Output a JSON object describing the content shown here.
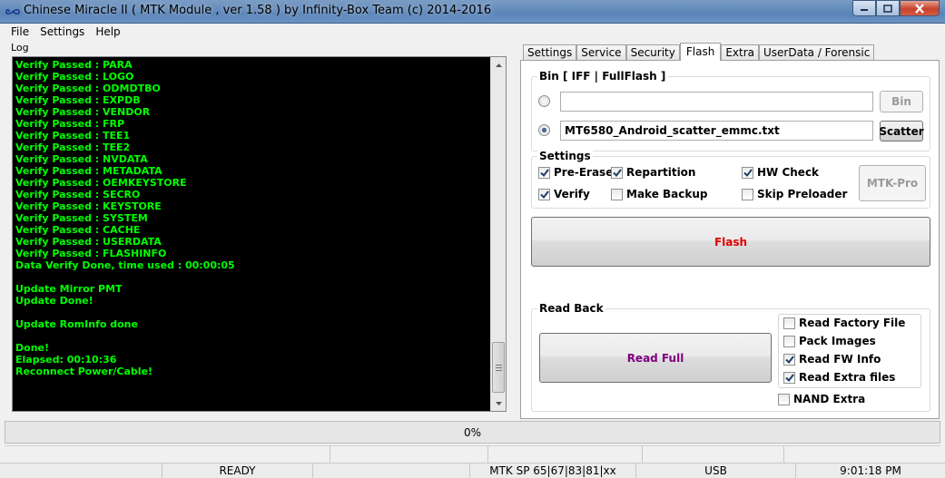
{
  "window": {
    "title": "Chinese Miracle II ( MTK Module , ver 1.58 ) by Infinity-Box Team (c) 2014-2016",
    "icon": "infinity-icon"
  },
  "menu": [
    "File",
    "Settings",
    "Help"
  ],
  "log": {
    "label": "Log",
    "lines": [
      "Verify Passed : PARA",
      "Verify Passed : LOGO",
      "Verify Passed : ODMDTBO",
      "Verify Passed : EXPDB",
      "Verify Passed : VENDOR",
      "Verify Passed : FRP",
      "Verify Passed : TEE1",
      "Verify Passed : TEE2",
      "Verify Passed : NVDATA",
      "Verify Passed : METADATA",
      "Verify Passed : OEMKEYSTORE",
      "Verify Passed : SECRO",
      "Verify Passed : KEYSTORE",
      "Verify Passed : SYSTEM",
      "Verify Passed : CACHE",
      "Verify Passed : USERDATA",
      "Verify Passed : FLASHINFO",
      "Data Verify Done, time used : 00:00:05",
      "",
      "Update Mirror PMT",
      "Update Done!",
      "",
      "Update RomInfo done",
      "",
      "Done!",
      "Elapsed: 00:10:36",
      "Reconnect Power/Cable!"
    ],
    "text_color": "#00ff00"
  },
  "tabs": [
    {
      "label": "Settings",
      "active": false
    },
    {
      "label": "Service",
      "active": false
    },
    {
      "label": "Security",
      "active": false
    },
    {
      "label": "Flash",
      "active": true
    },
    {
      "label": "Extra",
      "active": false
    },
    {
      "label": "UserData / Forensic",
      "active": false
    }
  ],
  "flash": {
    "bin_group": "Bin  [ IFF | FullFlash ]",
    "bin_path": "",
    "bin_button": "Bin",
    "scatter_path": "MT6580_Android_scatter_emmc.txt",
    "scatter_button": "Scatter",
    "settings_group": "Settings",
    "options": {
      "pre_erase": {
        "label": "Pre-Erase",
        "checked": true
      },
      "repartition": {
        "label": "Repartition",
        "checked": true
      },
      "hw_check": {
        "label": "HW Check",
        "checked": true
      },
      "verify": {
        "label": "Verify",
        "checked": true
      },
      "make_backup": {
        "label": "Make Backup",
        "checked": false
      },
      "skip_preloader": {
        "label": "Skip Preloader",
        "checked": false
      }
    },
    "mtk_pro_button": "MTK-Pro",
    "flash_button": "Flash",
    "flash_color": "#e00000",
    "readback_group": "Read Back",
    "read_full_button": "Read Full",
    "read_full_color": "#800080",
    "read_options": {
      "read_factory_file": {
        "label": "Read Factory File",
        "checked": false
      },
      "pack_images": {
        "label": "Pack Images",
        "checked": false
      },
      "read_fw_info": {
        "label": "Read FW Info",
        "checked": true
      },
      "read_extra_files": {
        "label": "Read Extra files",
        "checked": true
      }
    },
    "nand_extra": {
      "label": "NAND Extra",
      "checked": false
    }
  },
  "progress": {
    "text": "0%",
    "value": 0
  },
  "status": {
    "state": "READY",
    "chip": "MTK SP 65|67|83|81|xx",
    "port": "USB",
    "time": "9:01:18 PM"
  }
}
